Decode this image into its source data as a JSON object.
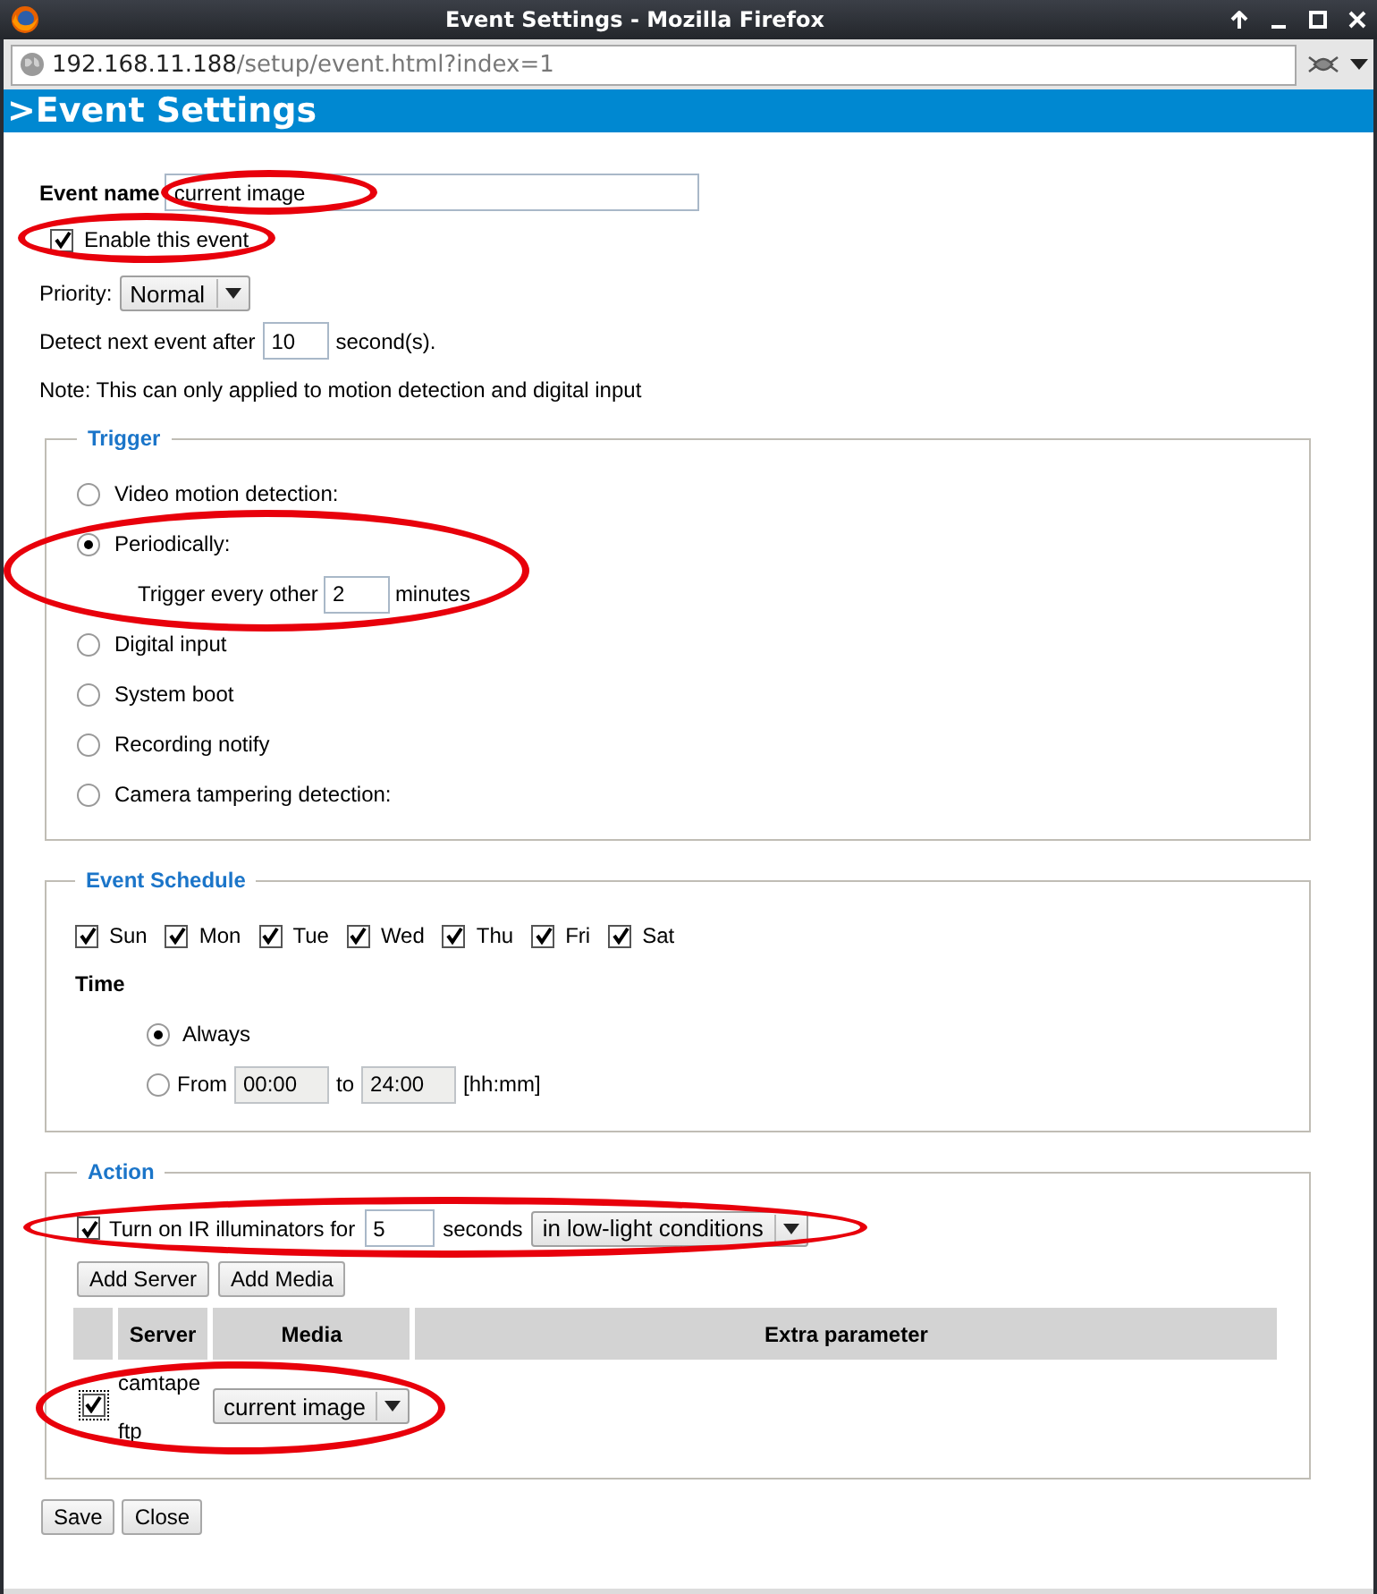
{
  "window": {
    "title": "Event Settings - Mozilla Firefox"
  },
  "address_bar": {
    "host": "192.168.11.188",
    "path": "/setup/event.html?index=1"
  },
  "header": {
    "title": ">Event Settings"
  },
  "event_name": {
    "label": "Event name",
    "value": "current image",
    "highlighted": true
  },
  "enable": {
    "label": "Enable this event",
    "checked": true,
    "highlighted": true
  },
  "priority": {
    "label": "Priority:",
    "value": "Normal"
  },
  "detect_next": {
    "label": "Detect next event after",
    "value": "10",
    "unit": "second(s)."
  },
  "note": "Note: This can only applied to motion detection and digital input",
  "trigger": {
    "title": "Trigger",
    "options": [
      {
        "label": "Video motion detection:",
        "selected": false
      },
      {
        "label": "Periodically:",
        "selected": true,
        "highlighted": true,
        "detail": {
          "label": "Trigger every other",
          "value": "2",
          "unit": "minutes"
        }
      },
      {
        "label": "Digital input",
        "selected": false
      },
      {
        "label": "System boot",
        "selected": false
      },
      {
        "label": "Recording notify",
        "selected": false
      },
      {
        "label": "Camera tampering detection:",
        "selected": false
      }
    ]
  },
  "schedule": {
    "title": "Event Schedule",
    "days": [
      {
        "label": "Sun",
        "checked": true
      },
      {
        "label": "Mon",
        "checked": true
      },
      {
        "label": "Tue",
        "checked": true
      },
      {
        "label": "Wed",
        "checked": true
      },
      {
        "label": "Thu",
        "checked": true
      },
      {
        "label": "Fri",
        "checked": true
      },
      {
        "label": "Sat",
        "checked": true
      }
    ],
    "time_label": "Time",
    "options": [
      {
        "kind": "always",
        "label": "Always",
        "selected": true
      },
      {
        "kind": "range",
        "label": "From",
        "from": "00:00",
        "to_label": "to",
        "to": "24:00",
        "format": "[hh:mm]",
        "selected": false
      }
    ]
  },
  "action": {
    "title": "Action",
    "ir": {
      "checked": true,
      "label": "Turn on IR illuminators for",
      "value": "5",
      "unit": "seconds",
      "mode": "in low-light conditions",
      "highlighted": true
    },
    "buttons": [
      "Add Server",
      "Add Media"
    ],
    "table": {
      "columns": [
        "Server",
        "Media",
        "Extra parameter"
      ],
      "rows": [
        {
          "checked": true,
          "server_name": "camtape",
          "server_type": "ftp",
          "media": "current image",
          "highlighted": true
        }
      ]
    }
  },
  "buttons": [
    "Save",
    "Close"
  ]
}
